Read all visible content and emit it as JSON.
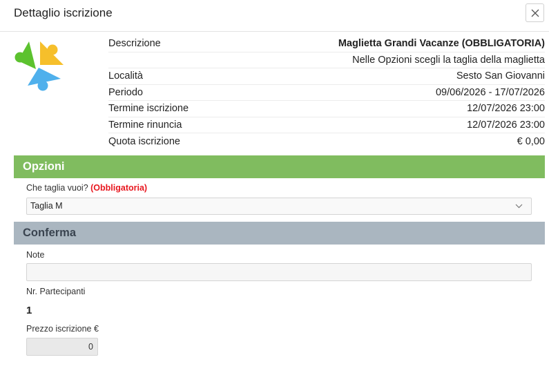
{
  "dialog": {
    "title": "Dettaglio iscrizione",
    "close_icon": "close-icon"
  },
  "details": [
    {
      "label": "Descrizione",
      "value": "Maglietta Grandi Vacanze (OBBLIGATORIA)"
    },
    {
      "label": "",
      "value": "Nelle Opzioni scegli la taglia della maglietta"
    },
    {
      "label": "Località",
      "value": "Sesto San Giovanni"
    },
    {
      "label": "Periodo",
      "value": "09/06/2026 - 17/07/2026"
    },
    {
      "label": "Termine iscrizione",
      "value": "12/07/2026 23:00"
    },
    {
      "label": "Termine rinuncia",
      "value": "12/07/2026 23:00"
    },
    {
      "label": "Quota iscrizione",
      "value": "€ 0,00"
    }
  ],
  "sections": {
    "opzioni": "Opzioni",
    "conferma": "Conferma"
  },
  "opzioni": {
    "question": "Che taglia vuoi?",
    "required": "(Obbligatoria)",
    "selected": "Taglia M"
  },
  "conferma": {
    "note_label": "Note",
    "note_value": "",
    "nr_label": "Nr. Partecipanti",
    "nr_value": "1",
    "price_label": "Prezzo iscrizione €",
    "price_value": "0"
  },
  "colors": {
    "opzioni_header": "#80bc5f",
    "conferma_header": "#aab6c0",
    "required": "#e8171f",
    "logo_green": "#5cc22f",
    "logo_yellow": "#f6bf2b",
    "logo_blue": "#4fb0ec"
  }
}
